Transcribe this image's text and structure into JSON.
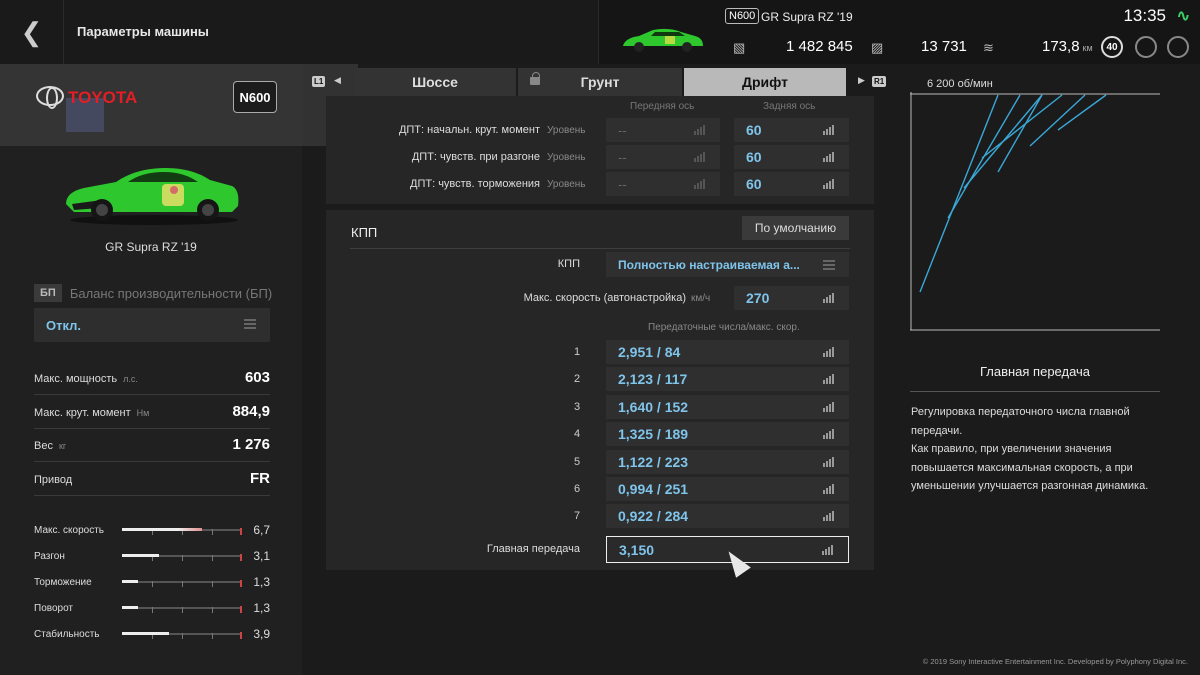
{
  "header": {
    "title": "Параметры машины",
    "car_class": "N600",
    "car_name": "GR Supra RZ '19",
    "credits": "1 482 845",
    "mileage_points": "13 731",
    "distance": "173,8",
    "distance_unit": "км",
    "level": "40",
    "time": "13:35"
  },
  "sidebar": {
    "brand": "TOYOTA",
    "car_class": "N600",
    "car_name": "GR Supra RZ '19",
    "bp_badge": "БП",
    "bp_label": "Баланс производительности (БП)",
    "bp_value": "Откл.",
    "specs": [
      {
        "label": "Макс. мощность",
        "unit": "л.с.",
        "value": "603"
      },
      {
        "label": "Макс. крут. момент",
        "unit": "Нм",
        "value": "884,9"
      },
      {
        "label": "Вес",
        "unit": "кг",
        "value": "1 276"
      },
      {
        "label": "Привод",
        "unit": "",
        "value": "FR"
      }
    ],
    "performance": [
      {
        "label": "Макс. скорость",
        "value": "6,7",
        "level": 0.67
      },
      {
        "label": "Разгон",
        "value": "3,1",
        "level": 0.31
      },
      {
        "label": "Торможение",
        "value": "1,3",
        "level": 0.13
      },
      {
        "label": "Поворот",
        "value": "1,3",
        "level": 0.13
      },
      {
        "label": "Стабильность",
        "value": "3,9",
        "level": 0.39
      }
    ]
  },
  "tabs": {
    "left_button": "L1",
    "right_button": "R1",
    "items": [
      {
        "label": "Шоссе",
        "state": "inactive"
      },
      {
        "label": "Грунт",
        "state": "locked"
      },
      {
        "label": "Дрифт",
        "state": "active"
      }
    ]
  },
  "diff": {
    "front_header": "Передняя ось",
    "rear_header": "Задняя ось",
    "unit": "Уровень",
    "rows": [
      {
        "label": "ДПТ: начальн. крут. момент",
        "front": "--",
        "rear": "60"
      },
      {
        "label": "ДПТ: чувств. при разгоне",
        "front": "--",
        "rear": "60"
      },
      {
        "label": "ДПТ: чувств. торможения",
        "front": "--",
        "rear": "60"
      }
    ]
  },
  "transmission": {
    "title": "КПП",
    "default_button": "По умолчанию",
    "type_label": "КПП",
    "type_value": "Полностью настраиваемая а...",
    "top_speed_label": "Макс. скорость (автонастройка)",
    "top_speed_unit": "км/ч",
    "top_speed_value": "270",
    "gears_header": "Передаточные числа/макс. скор.",
    "gears": [
      {
        "n": "1",
        "value": "2,951 / 84"
      },
      {
        "n": "2",
        "value": "2,123 / 117"
      },
      {
        "n": "3",
        "value": "1,640 / 152"
      },
      {
        "n": "4",
        "value": "1,325 / 189"
      },
      {
        "n": "5",
        "value": "1,122 / 223"
      },
      {
        "n": "6",
        "value": "0,994 / 251"
      },
      {
        "n": "7",
        "value": "0,922 / 284"
      }
    ],
    "final_label": "Главная передача",
    "final_value": "3,150"
  },
  "graph": {
    "rpm_label": "6 200 об/мин"
  },
  "info": {
    "title": "Главная передача",
    "text": "Регулировка передаточного числа главной передачи.\nКак правило, при увеличении значения повышается максимальная скорость, а при уменьшении улучшается разгонная динамика."
  },
  "footer": {
    "copyright": "© 2019 Sony Interactive Entertainment Inc. Developed by Polyphony Digital Inc."
  },
  "colors": {
    "accent_value": "#7fc4ea",
    "graph_line": "#3aa8d8",
    "brand_red": "#e31e24",
    "car_green": "#2ec82e"
  }
}
